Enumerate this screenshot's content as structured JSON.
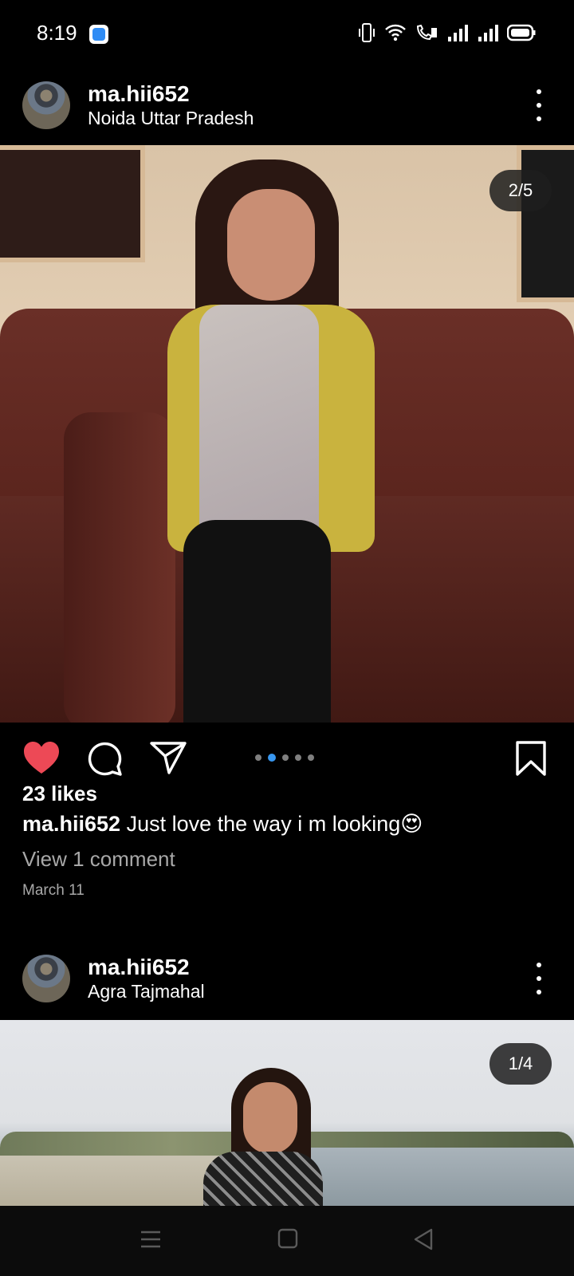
{
  "status_bar": {
    "time": "8:19",
    "icons": [
      "app-notification-icon",
      "vibrate-icon",
      "wifi-icon",
      "volte-call-icon",
      "signal-1-icon",
      "signal-2-icon",
      "battery-icon"
    ]
  },
  "posts": [
    {
      "username": "ma.hii652",
      "location": "Noida Uttar Pradesh",
      "image_counter": "2/5",
      "carousel": {
        "total": 5,
        "active_index": 1
      },
      "liked": true,
      "likes": "23 likes",
      "caption_user": "ma.hii652",
      "caption_text": "Just love the way i m looking😍",
      "view_comments": "View 1 comment",
      "date": "March 11"
    },
    {
      "username": "ma.hii652",
      "location": "Agra Tajmahal",
      "image_counter": "1/4"
    }
  ],
  "colors": {
    "like_red": "#ed4956",
    "carousel_active": "#3897f0",
    "muted_text": "#a8a8a8"
  },
  "nav_bar": {
    "icons": [
      "menu-icon",
      "home-square-icon",
      "back-triangle-icon"
    ]
  }
}
